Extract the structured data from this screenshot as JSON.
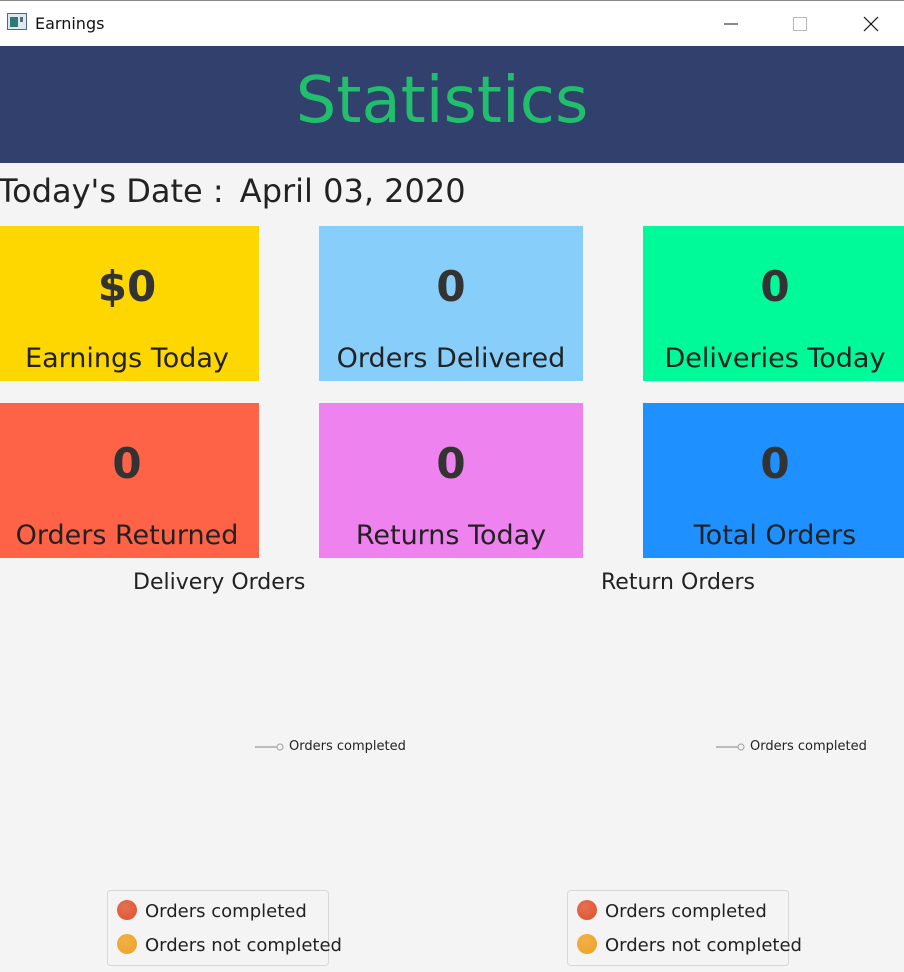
{
  "window": {
    "title": "Earnings",
    "icon": "app-window-icon"
  },
  "header": {
    "title": "Statistics",
    "bg_color": "#32406d",
    "title_color": "#21bf6b"
  },
  "date": {
    "label": "Today's Date :",
    "value": "April 03, 2020"
  },
  "cards": [
    {
      "value": "$0",
      "label": "Earnings Today",
      "color": "#ffd700"
    },
    {
      "value": "0",
      "label": "Orders Delivered",
      "color": "#87cefa"
    },
    {
      "value": "0",
      "label": "Deliveries Today",
      "color": "#00fa9a"
    },
    {
      "value": "0",
      "label": "Orders Returned",
      "color": "#ff6347"
    },
    {
      "value": "0",
      "label": "Returns Today",
      "color": "#ee82ee"
    },
    {
      "value": "0",
      "label": "Total Orders",
      "color": "#1e90ff"
    }
  ],
  "charts": [
    {
      "title": "Delivery Orders",
      "line_legend": "Orders completed",
      "legend": [
        {
          "label": "Orders completed",
          "color": "#e0502a"
        },
        {
          "label": "Orders not completed",
          "color": "#f0a020"
        }
      ]
    },
    {
      "title": "Return Orders",
      "line_legend": "Orders completed",
      "legend": [
        {
          "label": "Orders completed",
          "color": "#e0502a"
        },
        {
          "label": "Orders not completed",
          "color": "#f0a020"
        }
      ]
    }
  ]
}
